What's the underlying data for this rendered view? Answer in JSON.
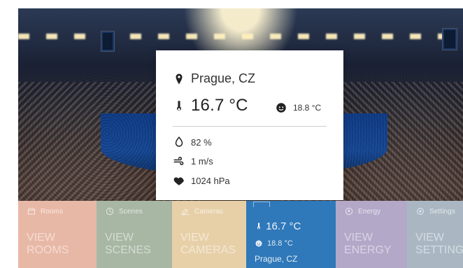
{
  "background": {
    "description": ""
  },
  "weather_card": {
    "location": "Prague, CZ",
    "temperature": "16.7 °C",
    "feels_like": "18.8 °C",
    "humidity": "82 %",
    "wind": "1 m/s",
    "pressure": "1024 hPa"
  },
  "tiles": [
    {
      "id": "rooms",
      "head": "Rooms",
      "main_line1": "VIEW",
      "main_line2": "ROOMS"
    },
    {
      "id": "scenes",
      "head": "Scenes",
      "main_line1": "VIEW",
      "main_line2": "SCENES"
    },
    {
      "id": "cameras",
      "head": "Cameras",
      "main_line1": "VIEW",
      "main_line2": "CAMERAS"
    },
    {
      "id": "weather",
      "head": "",
      "main_temp": "16.7 °C",
      "main_feels": "18.8 °C",
      "main_location": "Prague, CZ"
    },
    {
      "id": "energy",
      "head": "Energy",
      "main_line1": "VIEW",
      "main_line2": "ENERGY"
    },
    {
      "id": "settings",
      "head": "Settings",
      "main_line1": "VIEW",
      "main_line2": "SETTINGS"
    }
  ],
  "icons": {
    "location": "map-pin-icon",
    "temperature": "thermometer-icon",
    "feels_like": "face-icon",
    "humidity": "water-drop-icon",
    "wind": "wind-icon",
    "pressure": "heart-icon",
    "rooms": "rooms-icon",
    "scenes": "scenes-icon",
    "cameras": "camera-icon",
    "energy": "energy-icon",
    "settings": "settings-icon"
  }
}
